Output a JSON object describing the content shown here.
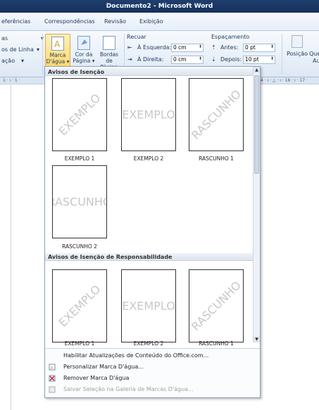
{
  "window": {
    "title": "Documento2 - Microsoft Word"
  },
  "tabs": [
    "eferências",
    "Correspondências",
    "Revisão",
    "Exibição"
  ],
  "ribbon": {
    "left_items": [
      "as",
      "os de Linha",
      "ação"
    ],
    "marca_dagua": {
      "line1": "Marca",
      "line2": "D'água"
    },
    "cor_pagina": {
      "line1": "Cor da",
      "line2": "Página"
    },
    "bordas_pagina": {
      "line1": "Bordas",
      "line2": "de Página"
    },
    "recuar": {
      "label": "Recuar",
      "esquerda_label": "À Esquerda:",
      "esquerda_value": "0 cm",
      "direita_label": "À Direita:",
      "direita_value": "0 cm"
    },
    "espacamento": {
      "label": "Espaçamento",
      "antes_label": "Antes:",
      "antes_value": "0 pt",
      "depois_label": "Depois:",
      "depois_value": "10 pt"
    },
    "posicao": "Posição",
    "que": "Que",
    "au": "Au"
  },
  "ruler": {
    "left": "1 · ı · 1 ·",
    "right": "4 · ı · △ · ı · 16 · ı · 17 ·"
  },
  "gallery": {
    "sections": [
      {
        "header": "Avisos de Isenção",
        "items": [
          {
            "caption": "EXEMPLO 1",
            "watermark": "EXEMPLO",
            "style": "diagonal"
          },
          {
            "caption": "EXEMPLO 2",
            "watermark": "EXEMPLO",
            "style": "horizontal"
          },
          {
            "caption": "RASCUNHO 1",
            "watermark": "RASCUNHO",
            "style": "diagonal"
          },
          {
            "caption": "RASCUNHO 2",
            "watermark": "RASCUNHO",
            "style": "horizontal"
          }
        ]
      },
      {
        "header": "Avisos de Isenção de Responsabilidade",
        "items": [
          {
            "caption": "EXEMPLO 1",
            "watermark": "EXEMPLO",
            "style": "diagonal"
          },
          {
            "caption": "EXEMPLO 2",
            "watermark": "EXEMPLO",
            "style": "horizontal"
          },
          {
            "caption": "RASCUNHO 1",
            "watermark": "RASCUNHO",
            "style": "diagonal"
          }
        ]
      }
    ],
    "menu": [
      {
        "label": "Habilitar Atualizações de Conteúdo do Office.com...",
        "icon": "",
        "enabled": true
      },
      {
        "label": "Personalizar Marca D'água...",
        "icon": "watermark-custom-icon",
        "enabled": true
      },
      {
        "label": "Remover Marca D'água",
        "icon": "watermark-remove-icon",
        "enabled": true
      },
      {
        "label": "Salvar Seleção na Galeria de Marcas D'água...",
        "icon": "save-gallery-icon",
        "enabled": false
      }
    ]
  }
}
